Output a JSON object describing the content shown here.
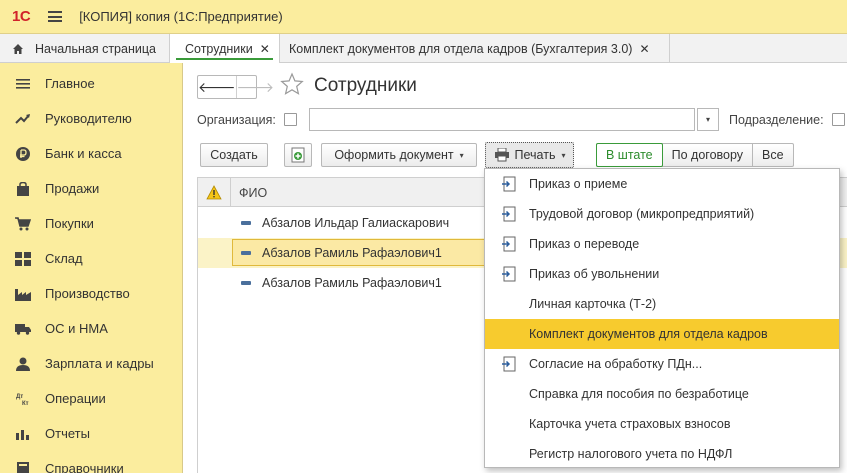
{
  "titlebar": {
    "logo": "1С",
    "title": "[КОПИЯ] копия  (1С:Предприятие)"
  },
  "tabs": [
    {
      "label": "Начальная страница",
      "icon": "home-icon"
    },
    {
      "label": "Сотрудники",
      "close": "✕"
    },
    {
      "label": "Комплект документов для отдела кадров (Бухгалтерия 3.0)",
      "close": "✕"
    }
  ],
  "sidebar": {
    "items": [
      {
        "label": "Главное",
        "icon": "list-icon"
      },
      {
        "label": "Руководителю",
        "icon": "trend-icon"
      },
      {
        "label": "Банк и касса",
        "icon": "ruble-icon"
      },
      {
        "label": "Продажи",
        "icon": "bag-icon"
      },
      {
        "label": "Покупки",
        "icon": "cart-icon"
      },
      {
        "label": "Склад",
        "icon": "warehouse-icon"
      },
      {
        "label": "Производство",
        "icon": "factory-icon"
      },
      {
        "label": "ОС и НМА",
        "icon": "truck-icon"
      },
      {
        "label": "Зарплата и кадры",
        "icon": "person-icon"
      },
      {
        "label": "Операции",
        "icon": "dt-kt-icon"
      },
      {
        "label": "Отчеты",
        "icon": "barchart-icon"
      },
      {
        "label": "Справочники",
        "icon": "book-icon"
      }
    ]
  },
  "main": {
    "title": "Сотрудники",
    "nav_back": "🡐",
    "nav_forward": "🡒",
    "org_label": "Организация:",
    "org_value": "",
    "org_dropdown": "▾",
    "dep_label": "Подразделение:",
    "toolbar": {
      "create": "Создать",
      "make_doc": "Оформить документ",
      "print": "Печать",
      "caret": "▾",
      "filters": [
        "В штате",
        "По договору",
        "Все"
      ],
      "active_filter": "В штате"
    },
    "table": {
      "columns": [
        "ФИО"
      ],
      "rows": [
        {
          "name": "Абзалов Ильдар Галиаскарович",
          "selected": false
        },
        {
          "name": "Абзалов Рамиль Рафаэлович1",
          "selected": true
        },
        {
          "name": "Абзалов Рамиль Рафаэлович1",
          "selected": false
        }
      ]
    }
  },
  "print_menu": {
    "items": [
      {
        "label": "Приказ о приеме",
        "icon": true
      },
      {
        "label": "Трудовой договор (микропредприятий)",
        "icon": true
      },
      {
        "label": "Приказ о переводе",
        "icon": true
      },
      {
        "label": "Приказ об увольнении",
        "icon": true
      },
      {
        "label": "Личная карточка (Т-2)",
        "icon": false
      },
      {
        "label": "Комплект документов для отдела кадров",
        "icon": false,
        "highlighted": true
      },
      {
        "label": "Согласие на обработку ПДн...",
        "icon": true
      },
      {
        "label": "Справка для пособия по безработице",
        "icon": false
      },
      {
        "label": "Карточка учета страховых взносов",
        "icon": false
      },
      {
        "label": "Регистр налогового учета по НДФЛ",
        "icon": false
      }
    ]
  },
  "colors": {
    "titlebar_bg": "#fbed9e",
    "accent_green": "#3a9b3a",
    "highlight_yellow": "#f7cb2e",
    "logo_red": "#d1232a"
  }
}
